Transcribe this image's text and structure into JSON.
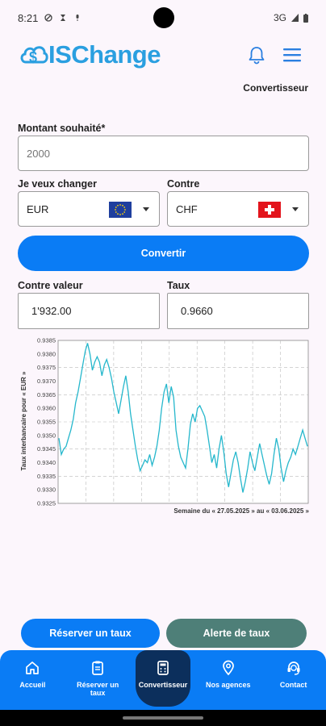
{
  "status": {
    "time": "8:21",
    "network": "3G"
  },
  "app": {
    "logo_text": "ISChange",
    "colors": {
      "brand": "#2a9fe0",
      "primary": "#0a7cf5",
      "secondary": "#4e7f78",
      "nav_active": "#0c2f5c"
    }
  },
  "header": {
    "breadcrumb": "Convertisseur",
    "bell_icon": "bell-icon",
    "menu_icon": "hamburger-menu-icon"
  },
  "form": {
    "amount_label": "Montant souhaité*",
    "amount_placeholder": "2000",
    "change_label": "Je veux changer",
    "change_value": "EUR",
    "against_label": "Contre",
    "against_value": "CHF",
    "convert_label": "Convertir",
    "counter_value_label": "Contre valeur",
    "counter_value": "1'932.00",
    "rate_label": "Taux",
    "rate_value": "0.9660"
  },
  "chart_data": {
    "type": "line",
    "title": "",
    "xlabel": "Semaine du « 27.05.2025 » au « 03.06.2025 »",
    "ylabel": "Taux interbancaire pour « EUR »",
    "ylim": [
      0.9325,
      0.9385
    ],
    "yticks": [
      "0.9385",
      "0.9380",
      "0.9375",
      "0.9370",
      "0.9365",
      "0.9360",
      "0.9355",
      "0.9350",
      "0.9345",
      "0.9340",
      "0.9335",
      "0.9330",
      "0.9325"
    ],
    "grid": true,
    "line_color": "#25b7cc",
    "series": [
      {
        "values": [
          0.9349,
          0.9343,
          0.9345,
          0.9346,
          0.9349,
          0.9352,
          0.9356,
          0.9362,
          0.9366,
          0.9371,
          0.9376,
          0.9381,
          0.9384,
          0.938,
          0.9374,
          0.9377,
          0.9379,
          0.9377,
          0.9372,
          0.9376,
          0.9378,
          0.9375,
          0.9371,
          0.9366,
          0.9362,
          0.9358,
          0.9363,
          0.9368,
          0.9372,
          0.9366,
          0.9358,
          0.9352,
          0.9346,
          0.9341,
          0.9337,
          0.9339,
          0.9341,
          0.934,
          0.9343,
          0.9339,
          0.9342,
          0.9346,
          0.9352,
          0.936,
          0.9366,
          0.9369,
          0.9362,
          0.9368,
          0.9364,
          0.9352,
          0.9346,
          0.9342,
          0.934,
          0.9338,
          0.9345,
          0.9354,
          0.9358,
          0.9355,
          0.936,
          0.9361,
          0.9359,
          0.9357,
          0.9352,
          0.9346,
          0.934,
          0.9343,
          0.9338,
          0.9345,
          0.935,
          0.9344,
          0.9336,
          0.9331,
          0.9336,
          0.9341,
          0.9344,
          0.934,
          0.9334,
          0.9329,
          0.9333,
          0.9338,
          0.9344,
          0.934,
          0.9337,
          0.9342,
          0.9347,
          0.9343,
          0.9339,
          0.9335,
          0.9332,
          0.9336,
          0.9343,
          0.9349,
          0.9345,
          0.9338,
          0.9333,
          0.9337,
          0.934,
          0.9342,
          0.9345,
          0.9343,
          0.9346,
          0.9349,
          0.9352,
          0.9349,
          0.9346
        ]
      }
    ]
  },
  "actions": {
    "reserve_label": "Réserver un taux",
    "alert_label": "Alerte de taux"
  },
  "nav": {
    "items": [
      {
        "label": "Accueil",
        "icon": "home-icon"
      },
      {
        "label": "Réserver un taux",
        "icon": "clipboard-icon"
      },
      {
        "label": "Convertisseur",
        "icon": "calculator-icon",
        "active": true
      },
      {
        "label": "Nos agences",
        "icon": "location-pin-icon"
      },
      {
        "label": "Contact",
        "icon": "headset-icon"
      }
    ]
  }
}
